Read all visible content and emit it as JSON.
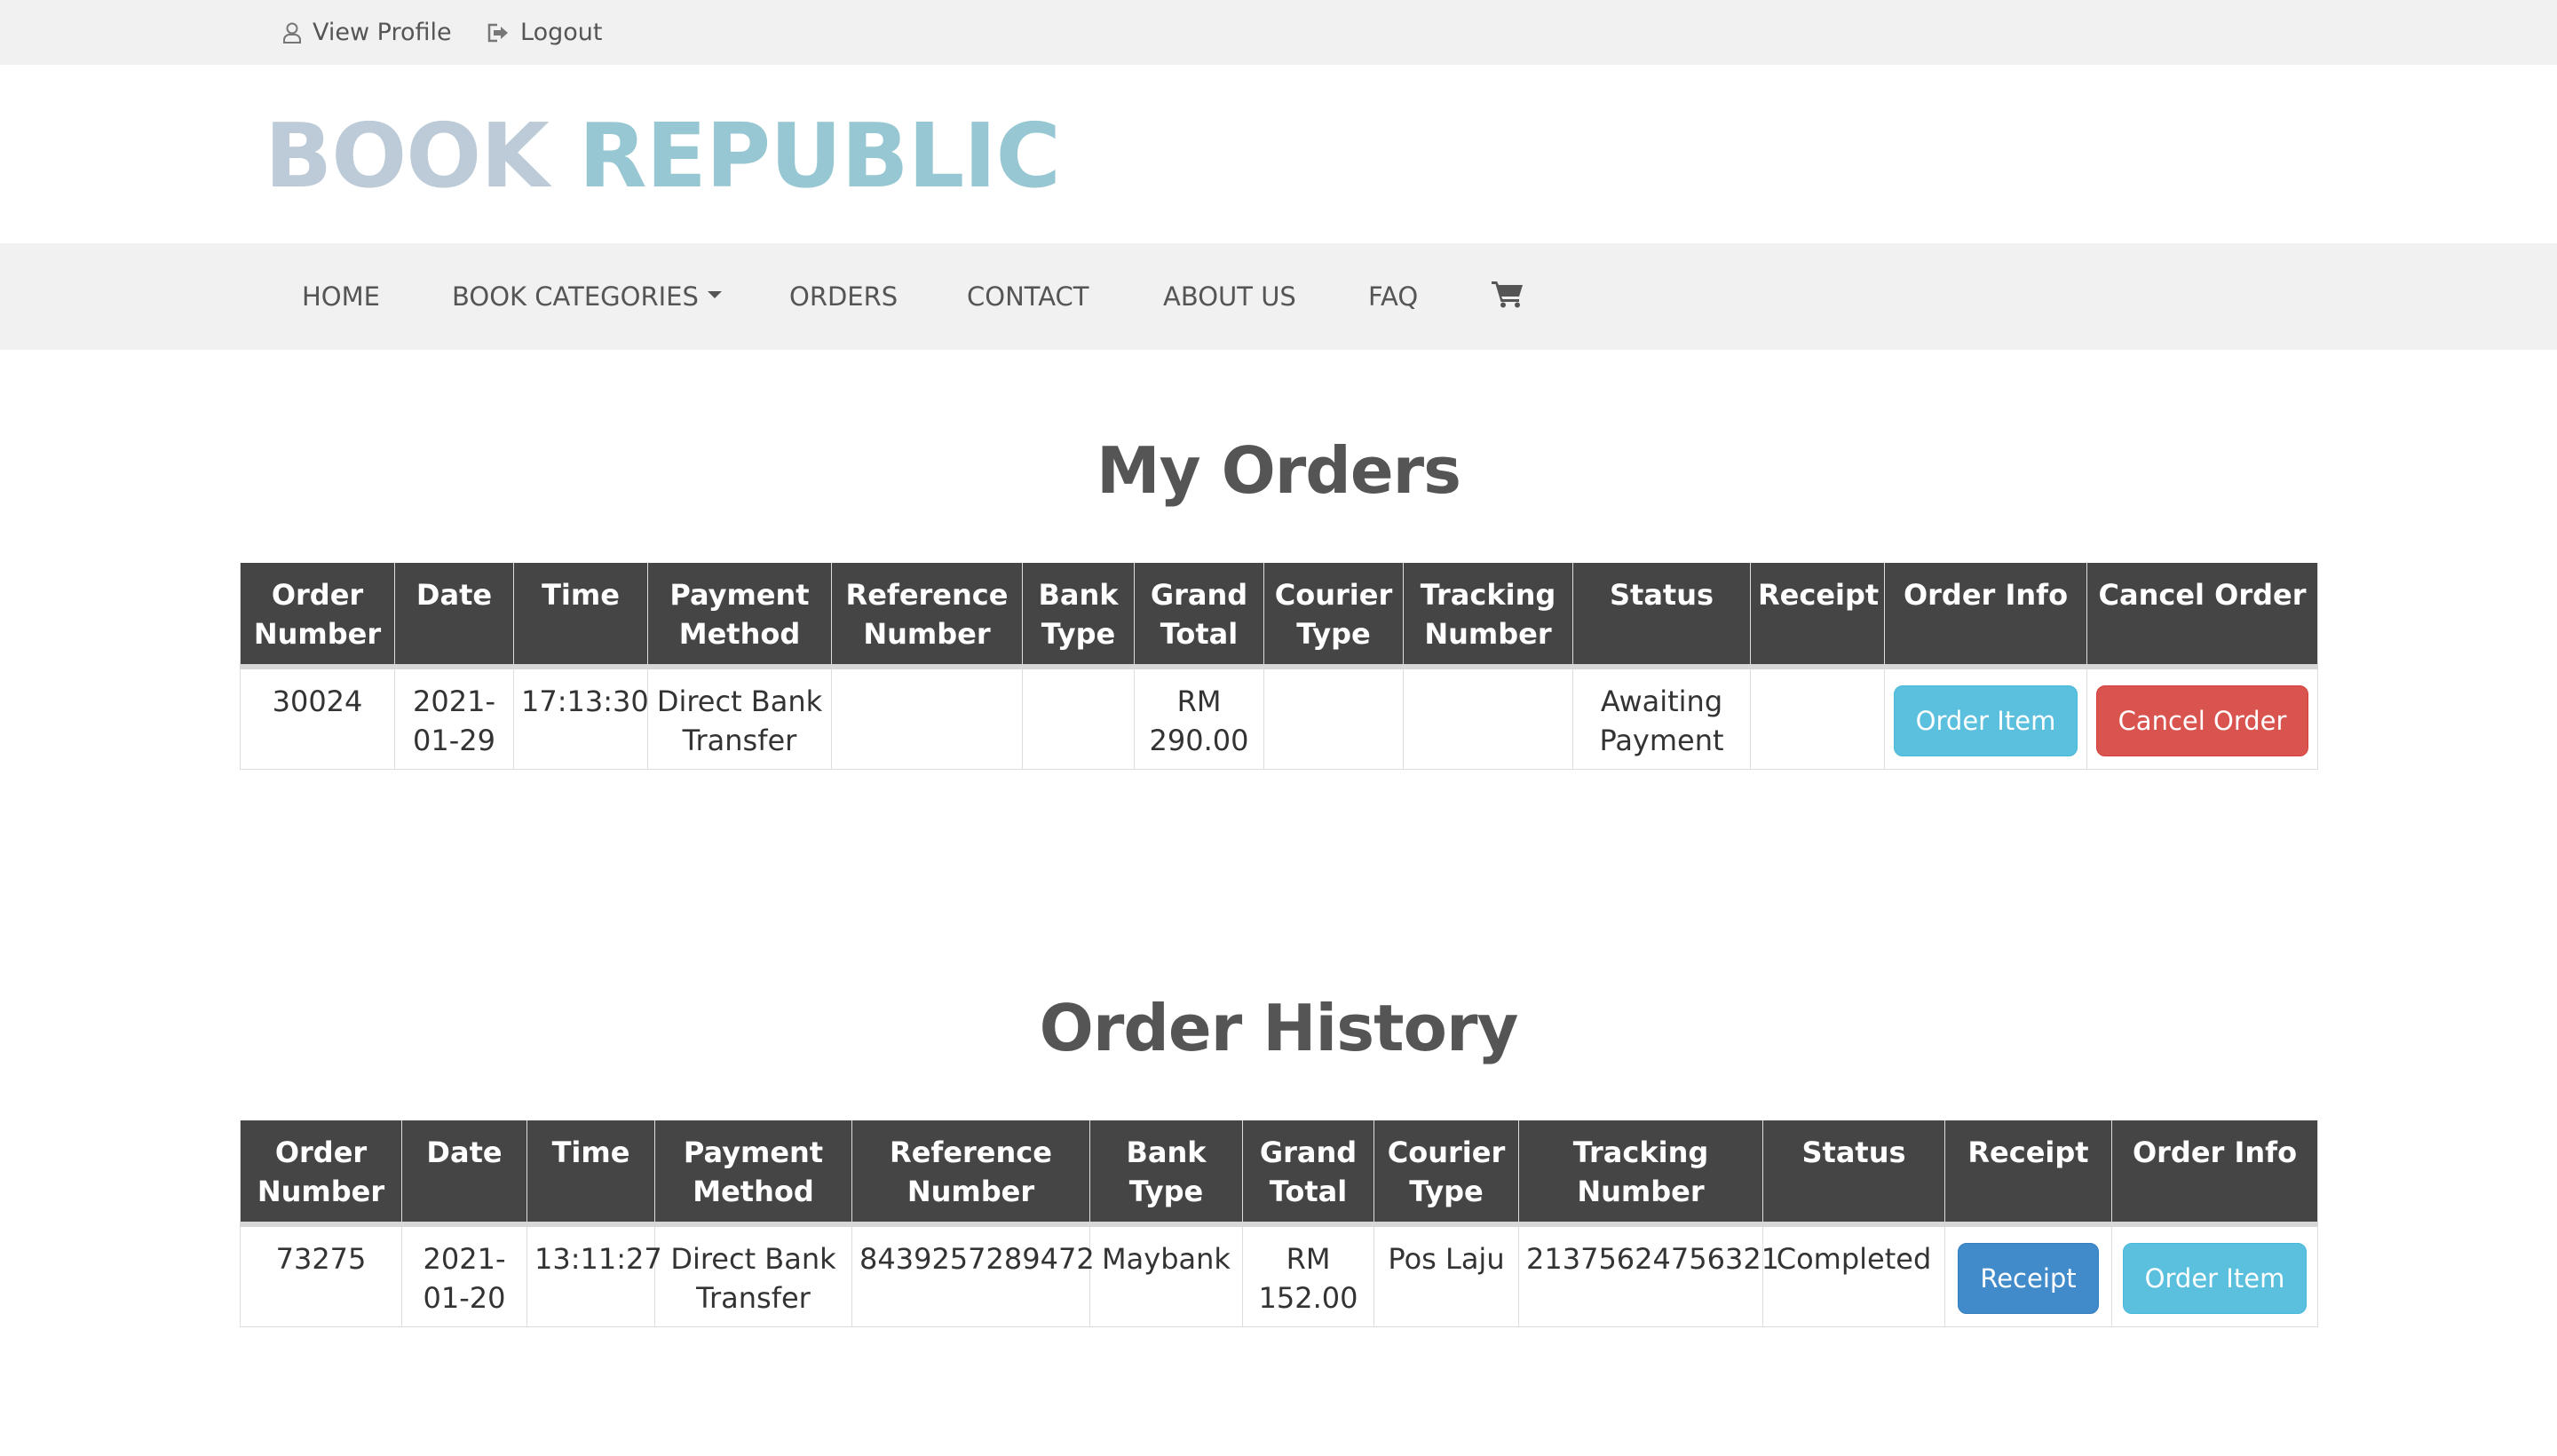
{
  "topbar": {
    "view_profile": "View Profile",
    "logout": "Logout"
  },
  "brand": {
    "word1": "BOOK",
    "word2": "REPUBLIC"
  },
  "nav": {
    "home": "HOME",
    "book_categories": "BOOK CATEGORIES",
    "orders": "ORDERS",
    "contact": "CONTACT",
    "about_us": "ABOUT US",
    "faq": "FAQ",
    "cart_icon": "cart-icon"
  },
  "my_orders": {
    "title": "My Orders",
    "headers": [
      "Order Number",
      "Date",
      "Time",
      "Payment Method",
      "Reference Number",
      "Bank Type",
      "Grand Total",
      "Courier Type",
      "Tracking Number",
      "Status",
      "Receipt",
      "Order Info",
      "Cancel Order"
    ],
    "rows": [
      {
        "order_number": "30024",
        "date": "2021-01-29",
        "time": "17:13:30",
        "payment_method": "Direct Bank Transfer",
        "reference_number": "",
        "bank_type": "",
        "grand_total": "RM 290.00",
        "courier_type": "",
        "tracking_number": "",
        "status": "Awaiting Payment",
        "receipt": "",
        "order_info_button": "Order Item",
        "cancel_button": "Cancel Order"
      }
    ]
  },
  "order_history": {
    "title": "Order History",
    "headers": [
      "Order Number",
      "Date",
      "Time",
      "Payment Method",
      "Reference Number",
      "Bank Type",
      "Grand Total",
      "Courier Type",
      "Tracking Number",
      "Status",
      "Receipt",
      "Order Info"
    ],
    "rows": [
      {
        "order_number": "73275",
        "date": "2021-01-20",
        "time": "13:11:27",
        "payment_method": "Direct Bank Transfer",
        "reference_number": "8439257289472",
        "bank_type": "Maybank",
        "grand_total": "RM 152.00",
        "courier_type": "Pos Laju",
        "tracking_number": "21375624756321",
        "status": "Completed",
        "receipt_button": "Receipt",
        "order_info_button": "Order Item"
      }
    ]
  },
  "colors": {
    "topbar_bg": "#f1f1f1",
    "brand_word1": "#bccbd7",
    "brand_word2": "#96c7d2",
    "table_header_bg": "#454545",
    "info": "#5bc0de",
    "danger": "#d9534f",
    "primary": "#428bca"
  }
}
